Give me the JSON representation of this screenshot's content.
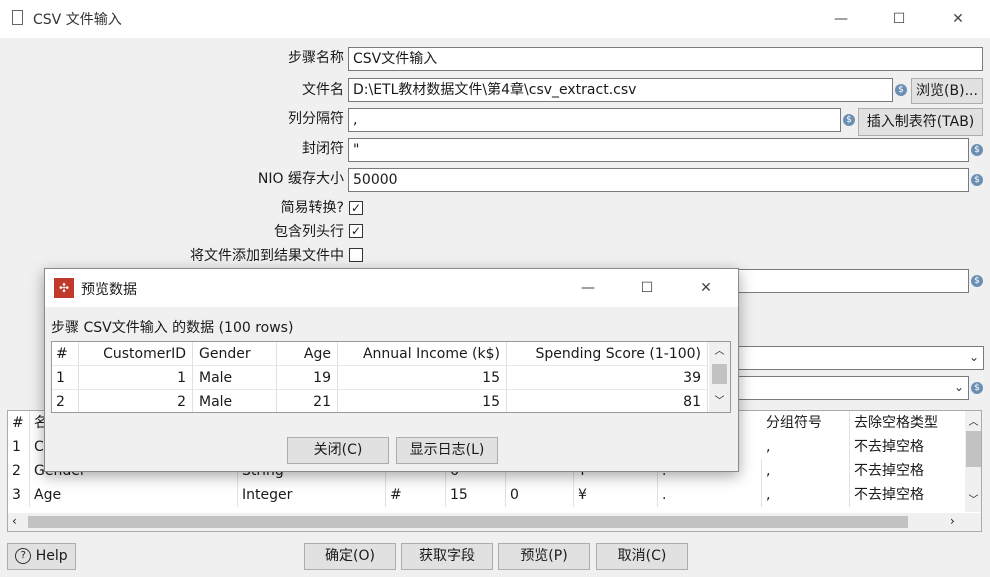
{
  "window": {
    "title": "CSV 文件输入",
    "minimize": "—",
    "maximize": "☐",
    "close": "✕"
  },
  "form": {
    "step_name_label": "步骤名称",
    "step_name_value": "CSV文件输入",
    "filename_label": "文件名",
    "filename_value": "D:\\ETL教材数据文件\\第4章\\csv_extract.csv",
    "browse_button": "浏览(B)...",
    "delimiter_label": "列分隔符",
    "delimiter_value": ",",
    "insert_tab_button": "插入制表符(TAB)",
    "enclosure_label": "封闭符",
    "enclosure_value": "\"",
    "nio_label": "NIO 缓存大小",
    "nio_value": "50000",
    "lazy_label": "简易转换?",
    "lazy_checked": true,
    "header_label": "包含列头行",
    "header_checked": true,
    "add_result_label": "将文件添加到结果文件中",
    "add_result_checked": false
  },
  "fields_table": {
    "headers": [
      "#",
      "名",
      "",
      "",
      "",
      "",
      "",
      "",
      "分组符号",
      "去除空格类型"
    ],
    "rows": [
      [
        "1",
        "C",
        "",
        "",
        "",
        "",
        "",
        "",
        ",",
        "不去掉空格"
      ],
      [
        "2",
        "Gender",
        "String",
        "",
        "6",
        "",
        "¥",
        ".",
        ",",
        "不去掉空格"
      ],
      [
        "3",
        "Age",
        "Integer",
        "#",
        "15",
        "0",
        "¥",
        ".",
        ",",
        "不去掉空格"
      ]
    ]
  },
  "bottom": {
    "help_button": "Help",
    "ok_button": "确定(O)",
    "get_fields_button": "获取字段",
    "preview_button": "预览(P)",
    "cancel_button": "取消(C)"
  },
  "preview_dialog": {
    "title": "预览数据",
    "subtitle": "步骤 CSV文件输入 的数据  (100 rows)",
    "columns": [
      "#",
      "CustomerID",
      "Gender",
      "Age",
      "Annual Income (k$)",
      "Spending Score (1-100)"
    ],
    "rows": [
      [
        "1",
        "1",
        "Male",
        "19",
        "15",
        "39"
      ],
      [
        "2",
        "2",
        "Male",
        "21",
        "15",
        "81"
      ]
    ],
    "close_button": "关闭(C)",
    "show_log_button": "显示日志(L)"
  }
}
